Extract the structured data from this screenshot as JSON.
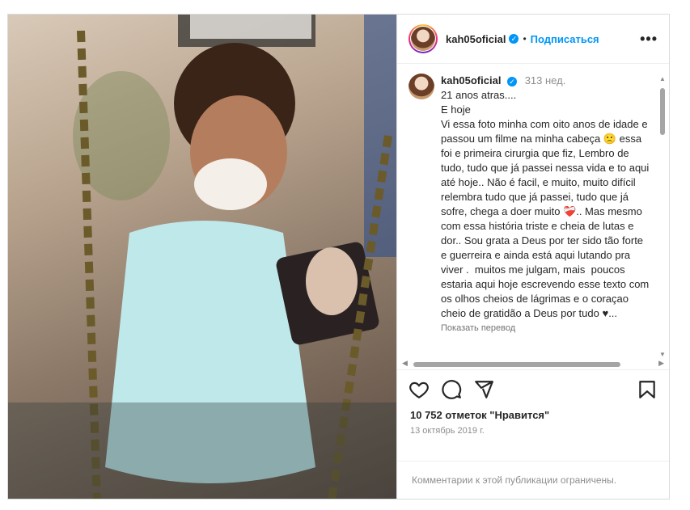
{
  "post": {
    "username": "kah05oficial",
    "follow_label": "Подписаться",
    "separator": "•",
    "more_label": "•••",
    "verified_glyph": "✓",
    "caption_age": "313 нед.",
    "caption": "21 anos atras....\nE hoje\nVi essa foto minha com oito anos de idade e passou um filme na minha cabeça 🙁 essa foi e primeira cirurgia que fiz, Lembro de tudo, tudo que já passei nessa vida e to aqui até hoje.. Não é facil, e muito, muito difícil relembra tudo que já passei, tudo que já sofre, chega a doer muito ❤️‍🩹.. Mas mesmo com essa história triste e cheia de lutas e dor.. Sou grata a Deus por ter sido tão forte e guerreira e ainda está aqui lutando pra viver .  muitos me julgam, mais  poucos estaria aqui hoje escrevendo esse texto com os olhos cheios de lágrimas e o coraçao cheio de gratidão a Deus por tudo ♥...",
    "translate_label": "Показать перевод",
    "likes": "10 752 отметок \"Нравится\"",
    "date": "13 октябрь 2019 г.",
    "comments_restricted": "Комментарии к этой публикации ограничены."
  },
  "icons": {
    "like": "heart-icon",
    "comment": "comment-icon",
    "share": "share-icon",
    "save": "bookmark-icon"
  },
  "colors": {
    "accent": "#0095f6",
    "text": "#262626",
    "muted": "#8e8e8e"
  }
}
